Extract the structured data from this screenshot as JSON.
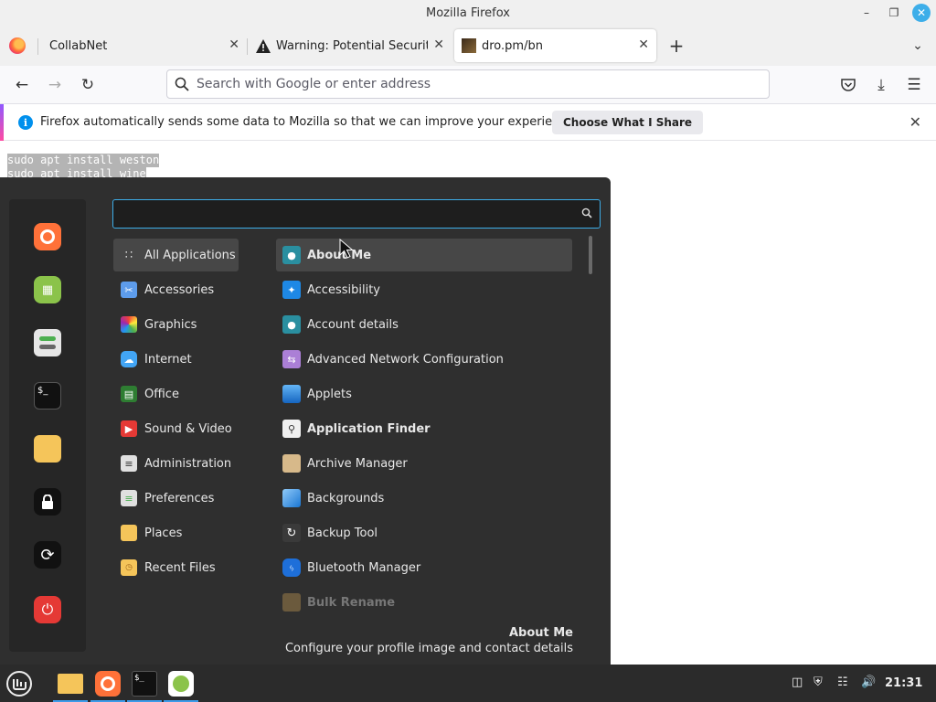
{
  "window": {
    "title": "Mozilla Firefox"
  },
  "tabs": [
    {
      "label": "CollabNet",
      "active": false
    },
    {
      "label": "Warning: Potential Security",
      "active": false
    },
    {
      "label": "dro.pm/bn",
      "active": true
    }
  ],
  "urlbar": {
    "placeholder": "Search with Google or enter address",
    "value": ""
  },
  "notification": {
    "text": "Firefox automatically sends some data to Mozilla so that we can improve your experience.",
    "button": "Choose What I Share"
  },
  "page": {
    "lines": [
      "sudo apt install weston",
      "sudo apt install wine"
    ]
  },
  "menu": {
    "search": {
      "value": ""
    },
    "favorites": [
      "firefox-icon",
      "calculator-icon",
      "settings-toggle-icon",
      "terminal-icon",
      "folder-icon",
      "lock-icon",
      "logout-icon",
      "power-icon"
    ],
    "categories": [
      {
        "label": "All Applications",
        "icon": "grid-icon",
        "selected": true
      },
      {
        "label": "Accessories",
        "icon": "scissors-icon"
      },
      {
        "label": "Graphics",
        "icon": "palette-icon"
      },
      {
        "label": "Internet",
        "icon": "cloud-icon"
      },
      {
        "label": "Office",
        "icon": "office-icon"
      },
      {
        "label": "Sound & Video",
        "icon": "play-icon"
      },
      {
        "label": "Administration",
        "icon": "admin-icon"
      },
      {
        "label": "Preferences",
        "icon": "prefs-icon"
      },
      {
        "label": "Places",
        "icon": "folder-icon"
      },
      {
        "label": "Recent Files",
        "icon": "recent-folder-icon"
      }
    ],
    "apps": [
      {
        "label": "About Me",
        "icon": "user-icon",
        "selected": true,
        "bold": true
      },
      {
        "label": "Accessibility",
        "icon": "accessibility-icon"
      },
      {
        "label": "Account details",
        "icon": "account-icon"
      },
      {
        "label": "Advanced Network Configuration",
        "icon": "network-icon"
      },
      {
        "label": "Applets",
        "icon": "applets-icon"
      },
      {
        "label": "Application Finder",
        "icon": "finder-icon",
        "bold": true
      },
      {
        "label": "Archive Manager",
        "icon": "archive-icon"
      },
      {
        "label": "Backgrounds",
        "icon": "backgrounds-icon"
      },
      {
        "label": "Backup Tool",
        "icon": "backup-icon"
      },
      {
        "label": "Bluetooth Manager",
        "icon": "bluetooth-icon"
      },
      {
        "label": "Bulk Rename",
        "icon": "rename-icon",
        "bold": true,
        "dim": true
      }
    ],
    "description": {
      "title": "About Me",
      "text": "Configure your profile image and contact details"
    }
  },
  "taskbar": {
    "items": [
      "menu-icon",
      "files-icon",
      "firefox-icon",
      "terminal-icon",
      "calculator-icon"
    ],
    "clock": "21:31"
  },
  "colors": {
    "accent": "#3daee9",
    "menu_bg": "#2f2f2f",
    "taskbar_bg": "#2b2b2b"
  }
}
